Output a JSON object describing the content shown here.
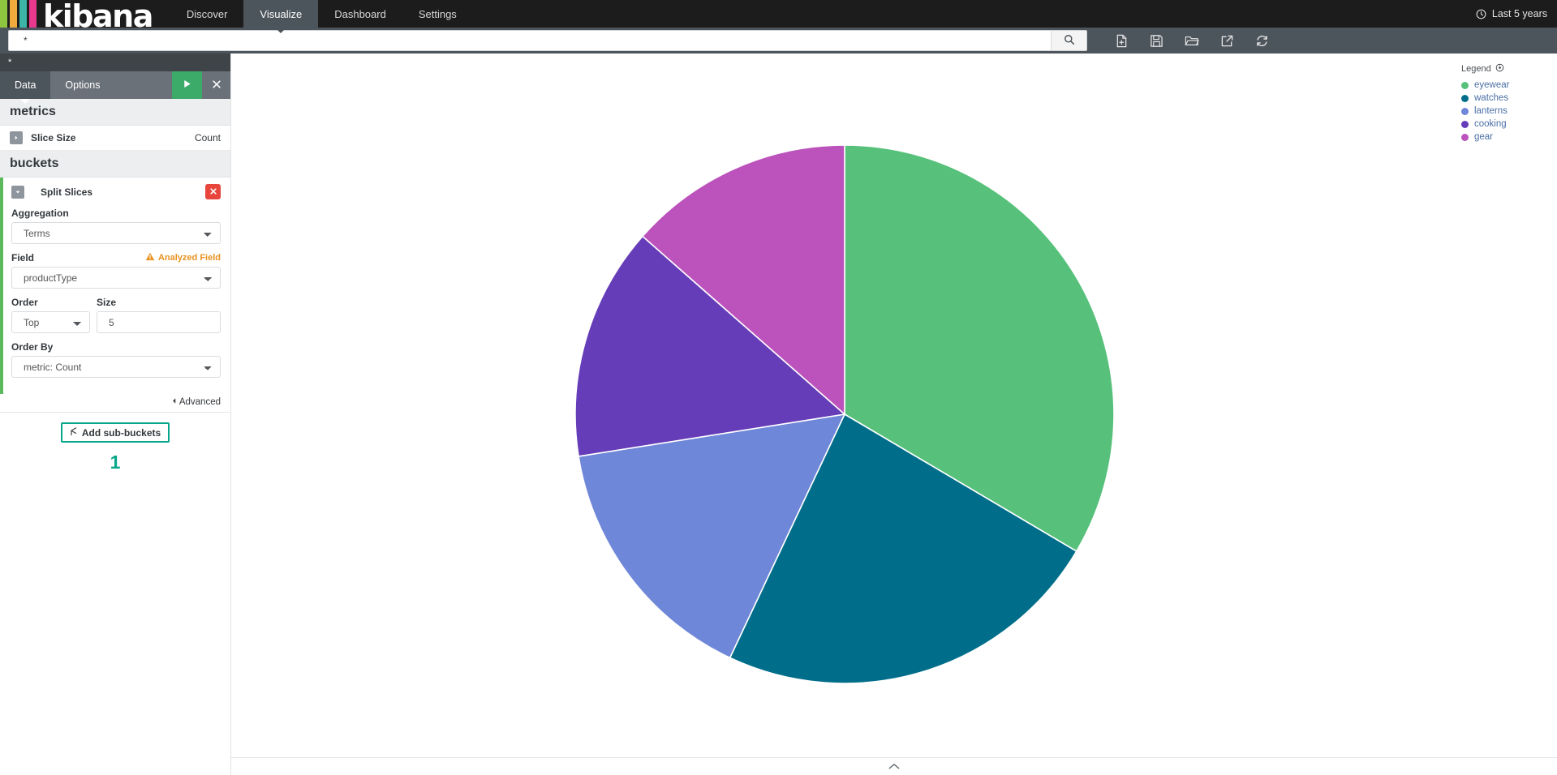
{
  "navbar": {
    "logo_text": "kibana",
    "logo_bar_colors": [
      "#8fc640",
      "#f0ab3c",
      "#3cb4a6",
      "#e8398e"
    ],
    "items": [
      {
        "label": "Discover",
        "active": false
      },
      {
        "label": "Visualize",
        "active": true
      },
      {
        "label": "Dashboard",
        "active": false
      },
      {
        "label": "Settings",
        "active": false
      }
    ],
    "timepicker_label": "Last 5 years",
    "clock_icon": "clock-icon"
  },
  "querybar": {
    "query_value": "*",
    "query_placeholder": "",
    "search_icon": "search-icon",
    "toolbar_icons": [
      {
        "name": "new-visualization-icon",
        "title": "New Visualization"
      },
      {
        "name": "save-icon",
        "title": "Save"
      },
      {
        "name": "open-icon",
        "title": "Open"
      },
      {
        "name": "share-icon",
        "title": "Share"
      },
      {
        "name": "refresh-icon",
        "title": "Refresh"
      }
    ]
  },
  "sidebar": {
    "index_name": "*",
    "tabs": [
      {
        "label": "Data",
        "active": true
      },
      {
        "label": "Options",
        "active": false
      }
    ],
    "apply_icon": "play-icon",
    "discard_icon": "close-icon",
    "metrics": {
      "heading": "metrics",
      "rows": [
        {
          "label": "Slice Size",
          "value": "Count",
          "toggle_icon": "chevron-right-icon"
        }
      ]
    },
    "buckets": {
      "heading": "buckets",
      "bucket": {
        "title": "Split Slices",
        "toggle_icon": "chevron-down-icon",
        "remove_icon": "close-icon",
        "aggregation_label": "Aggregation",
        "aggregation_value": "Terms",
        "field_label": "Field",
        "analyzed_warning": "Analyzed Field",
        "warning_icon": "warning-triangle-icon",
        "field_value": "productType",
        "order_label": "Order",
        "order_value": "Top",
        "size_label": "Size",
        "size_value": "5",
        "order_by_label": "Order By",
        "order_by_value": "metric: Count",
        "advanced_label": "Advanced",
        "advanced_icon": "chevron-left-icon",
        "add_subbuckets_label": "Add sub-buckets",
        "add_subbuckets_icon": "split-icon",
        "annotation_number": "1",
        "annotation_color": "#08a68a"
      }
    }
  },
  "legend": {
    "title": "Legend",
    "title_icon": "gear-icon",
    "items": [
      {
        "label": "eyewear",
        "color": "#57c17b"
      },
      {
        "label": "watches",
        "color": "#006e8a"
      },
      {
        "label": "lanterns",
        "color": "#6f87d8"
      },
      {
        "label": "cooking",
        "color": "#663db8"
      },
      {
        "label": "gear",
        "color": "#bc52bc"
      }
    ]
  },
  "chart_data": {
    "type": "pie",
    "title": "",
    "legend_position": "right",
    "labels": [
      "eyewear",
      "watches",
      "lanterns",
      "cooking",
      "gear"
    ],
    "values": [
      33.5,
      23.5,
      15.5,
      14.0,
      13.5
    ],
    "colors": [
      "#57c17b",
      "#006e8a",
      "#6f87d8",
      "#663db8",
      "#bc52bc"
    ],
    "metric": "Count",
    "field": "productType",
    "slice_border_color": "#ffffff"
  },
  "bottom_bar": {
    "collapse_icon": "chevron-up-icon"
  }
}
